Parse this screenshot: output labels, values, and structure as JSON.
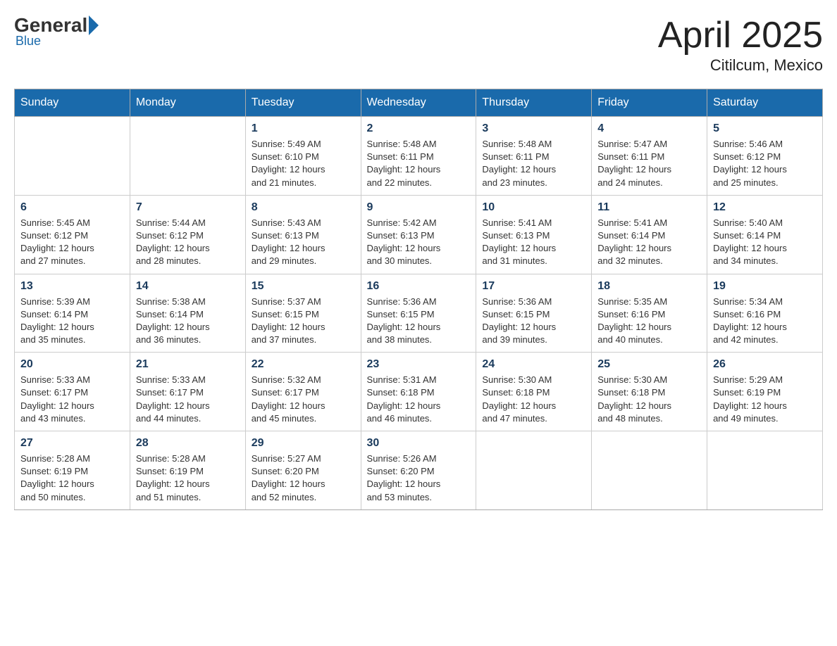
{
  "header": {
    "logo": {
      "part1": "General",
      "part2": "Blue"
    },
    "title": "April 2025",
    "subtitle": "Citilcum, Mexico"
  },
  "days_of_week": [
    "Sunday",
    "Monday",
    "Tuesday",
    "Wednesday",
    "Thursday",
    "Friday",
    "Saturday"
  ],
  "weeks": [
    [
      {
        "day": "",
        "info": ""
      },
      {
        "day": "",
        "info": ""
      },
      {
        "day": "1",
        "info": "Sunrise: 5:49 AM\nSunset: 6:10 PM\nDaylight: 12 hours\nand 21 minutes."
      },
      {
        "day": "2",
        "info": "Sunrise: 5:48 AM\nSunset: 6:11 PM\nDaylight: 12 hours\nand 22 minutes."
      },
      {
        "day": "3",
        "info": "Sunrise: 5:48 AM\nSunset: 6:11 PM\nDaylight: 12 hours\nand 23 minutes."
      },
      {
        "day": "4",
        "info": "Sunrise: 5:47 AM\nSunset: 6:11 PM\nDaylight: 12 hours\nand 24 minutes."
      },
      {
        "day": "5",
        "info": "Sunrise: 5:46 AM\nSunset: 6:12 PM\nDaylight: 12 hours\nand 25 minutes."
      }
    ],
    [
      {
        "day": "6",
        "info": "Sunrise: 5:45 AM\nSunset: 6:12 PM\nDaylight: 12 hours\nand 27 minutes."
      },
      {
        "day": "7",
        "info": "Sunrise: 5:44 AM\nSunset: 6:12 PM\nDaylight: 12 hours\nand 28 minutes."
      },
      {
        "day": "8",
        "info": "Sunrise: 5:43 AM\nSunset: 6:13 PM\nDaylight: 12 hours\nand 29 minutes."
      },
      {
        "day": "9",
        "info": "Sunrise: 5:42 AM\nSunset: 6:13 PM\nDaylight: 12 hours\nand 30 minutes."
      },
      {
        "day": "10",
        "info": "Sunrise: 5:41 AM\nSunset: 6:13 PM\nDaylight: 12 hours\nand 31 minutes."
      },
      {
        "day": "11",
        "info": "Sunrise: 5:41 AM\nSunset: 6:14 PM\nDaylight: 12 hours\nand 32 minutes."
      },
      {
        "day": "12",
        "info": "Sunrise: 5:40 AM\nSunset: 6:14 PM\nDaylight: 12 hours\nand 34 minutes."
      }
    ],
    [
      {
        "day": "13",
        "info": "Sunrise: 5:39 AM\nSunset: 6:14 PM\nDaylight: 12 hours\nand 35 minutes."
      },
      {
        "day": "14",
        "info": "Sunrise: 5:38 AM\nSunset: 6:14 PM\nDaylight: 12 hours\nand 36 minutes."
      },
      {
        "day": "15",
        "info": "Sunrise: 5:37 AM\nSunset: 6:15 PM\nDaylight: 12 hours\nand 37 minutes."
      },
      {
        "day": "16",
        "info": "Sunrise: 5:36 AM\nSunset: 6:15 PM\nDaylight: 12 hours\nand 38 minutes."
      },
      {
        "day": "17",
        "info": "Sunrise: 5:36 AM\nSunset: 6:15 PM\nDaylight: 12 hours\nand 39 minutes."
      },
      {
        "day": "18",
        "info": "Sunrise: 5:35 AM\nSunset: 6:16 PM\nDaylight: 12 hours\nand 40 minutes."
      },
      {
        "day": "19",
        "info": "Sunrise: 5:34 AM\nSunset: 6:16 PM\nDaylight: 12 hours\nand 42 minutes."
      }
    ],
    [
      {
        "day": "20",
        "info": "Sunrise: 5:33 AM\nSunset: 6:17 PM\nDaylight: 12 hours\nand 43 minutes."
      },
      {
        "day": "21",
        "info": "Sunrise: 5:33 AM\nSunset: 6:17 PM\nDaylight: 12 hours\nand 44 minutes."
      },
      {
        "day": "22",
        "info": "Sunrise: 5:32 AM\nSunset: 6:17 PM\nDaylight: 12 hours\nand 45 minutes."
      },
      {
        "day": "23",
        "info": "Sunrise: 5:31 AM\nSunset: 6:18 PM\nDaylight: 12 hours\nand 46 minutes."
      },
      {
        "day": "24",
        "info": "Sunrise: 5:30 AM\nSunset: 6:18 PM\nDaylight: 12 hours\nand 47 minutes."
      },
      {
        "day": "25",
        "info": "Sunrise: 5:30 AM\nSunset: 6:18 PM\nDaylight: 12 hours\nand 48 minutes."
      },
      {
        "day": "26",
        "info": "Sunrise: 5:29 AM\nSunset: 6:19 PM\nDaylight: 12 hours\nand 49 minutes."
      }
    ],
    [
      {
        "day": "27",
        "info": "Sunrise: 5:28 AM\nSunset: 6:19 PM\nDaylight: 12 hours\nand 50 minutes."
      },
      {
        "day": "28",
        "info": "Sunrise: 5:28 AM\nSunset: 6:19 PM\nDaylight: 12 hours\nand 51 minutes."
      },
      {
        "day": "29",
        "info": "Sunrise: 5:27 AM\nSunset: 6:20 PM\nDaylight: 12 hours\nand 52 minutes."
      },
      {
        "day": "30",
        "info": "Sunrise: 5:26 AM\nSunset: 6:20 PM\nDaylight: 12 hours\nand 53 minutes."
      },
      {
        "day": "",
        "info": ""
      },
      {
        "day": "",
        "info": ""
      },
      {
        "day": "",
        "info": ""
      }
    ]
  ]
}
